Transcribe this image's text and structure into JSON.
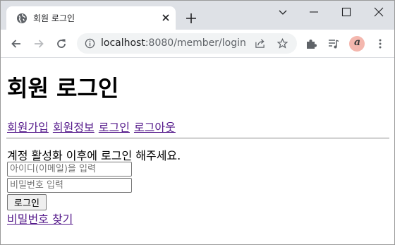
{
  "browser": {
    "tab_title": "회원 로그인",
    "url_host": "localhost",
    "url_path": ":8080/member/login",
    "avatar_letter": "a",
    "icons": [
      "globe-icon",
      "close-icon",
      "plus-icon",
      "chevron-down-icon",
      "minimize-icon",
      "maximize-icon",
      "window-close-icon",
      "back-arrow-icon",
      "forward-arrow-icon",
      "reload-icon",
      "info-icon",
      "share-icon",
      "star-icon",
      "puzzle-icon",
      "media-queue-icon",
      "kebab-menu-icon"
    ],
    "colors": {
      "tabstrip": "#dee1e6",
      "omnibox": "#f1f3f4",
      "avatar": "#f4b7ae"
    }
  },
  "page": {
    "title": "회원 로그인",
    "nav": [
      {
        "label": "회원가입"
      },
      {
        "label": "회원정보"
      },
      {
        "label": "로그인"
      },
      {
        "label": "로그아웃"
      }
    ],
    "notice": "계정 활성화 이후에 로그인 해주세요.",
    "email_placeholder": "아이디(이메일)을 입력",
    "password_placeholder": "비밀번호 입력",
    "login_button": "로그인",
    "find_password_link": "비밀번호 찾기",
    "colors": {
      "link": "#551a8b"
    }
  }
}
